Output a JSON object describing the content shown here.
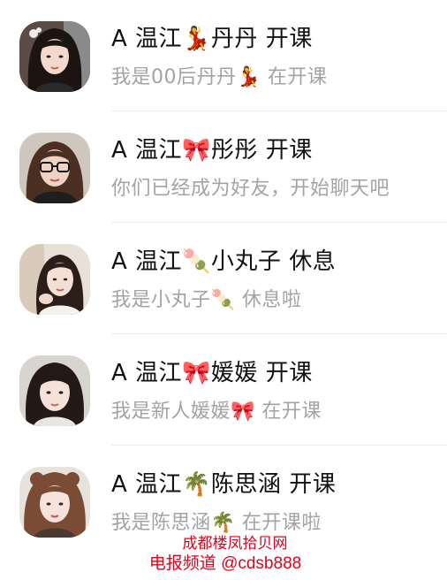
{
  "chats": [
    {
      "name": "A 温江💃丹丹 开课",
      "preview": "我是00后丹丹💃    在开课",
      "avatar_icon": "girl-photo-avatar"
    },
    {
      "name": "A 温江🎀彤彤 开课",
      "preview": "你们已经成为好友，开始聊天吧",
      "avatar_icon": "girl-with-glasses-avatar"
    },
    {
      "name": "A 温江🍡小丸子 休息",
      "preview": "我是小丸子🍡      休息啦",
      "avatar_icon": "girl-photo-avatar"
    },
    {
      "name": "A 温江🎀媛媛 开课",
      "preview": "我是新人媛媛🎀   在开课",
      "avatar_icon": "girl-photo-avatar"
    },
    {
      "name": "A 温江🌴陈思涵 开课",
      "preview": "我是陈思涵🌴     在开课啦",
      "avatar_icon": "girl-photo-avatar"
    }
  ],
  "watermark": {
    "line1": "成都楼凤拾贝网",
    "line2": "电报频道 @cdsb888"
  },
  "colors": {
    "name_text": "#111111",
    "preview_text": "#a3a3a3",
    "divider": "#ececec",
    "watermark": "#e3001b"
  }
}
